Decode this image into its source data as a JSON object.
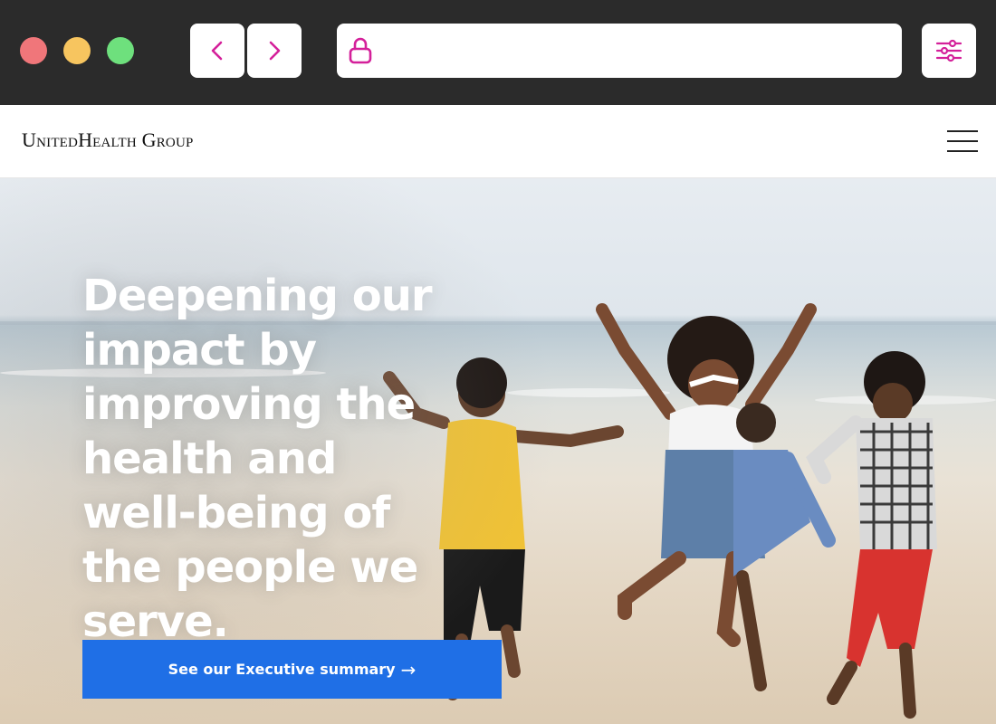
{
  "browser": {
    "traffic_lights": [
      {
        "name": "close",
        "color": "#f0767a"
      },
      {
        "name": "minimize",
        "color": "#f7c55f"
      },
      {
        "name": "maximize",
        "color": "#6ee07d"
      }
    ],
    "back_icon": "chevron-left-icon",
    "forward_icon": "chevron-right-icon",
    "lock_icon": "lock-icon",
    "settings_icon": "sliders-icon",
    "url_value": "",
    "accent_color": "#d4209a"
  },
  "header": {
    "logo_text": "UnitedHealth Group",
    "menu_icon": "hamburger-menu-icon"
  },
  "hero": {
    "headline": "Deepening our impact by improving the health and well-being of the people we serve.",
    "cta_label": "See our Executive summary",
    "cta_arrow": "→",
    "cta_color": "#1f6fe6"
  }
}
